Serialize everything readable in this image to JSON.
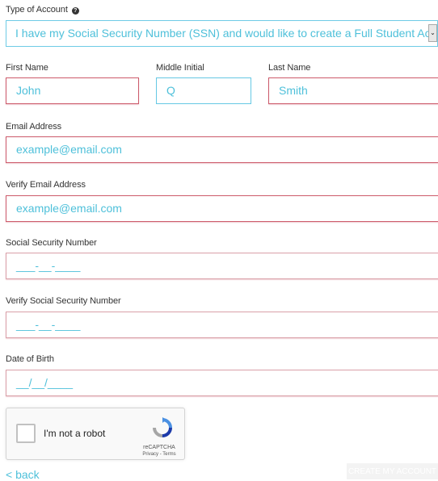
{
  "account_type": {
    "label": "Type of Account",
    "selected": "I have my Social Security Number (SSN) and would like to create a Full Student Account",
    "arrow": "⌄"
  },
  "name": {
    "first_label": "First Name",
    "first_placeholder": "John",
    "middle_label": "Middle Initial",
    "middle_placeholder": "Q",
    "last_label": "Last Name",
    "last_placeholder": "Smith"
  },
  "email": {
    "label": "Email Address",
    "placeholder": "example@email.com"
  },
  "verify_email": {
    "label": "Verify Email Address",
    "placeholder": "example@email.com"
  },
  "ssn": {
    "label": "Social Security Number",
    "placeholder": "___-__-____"
  },
  "verify_ssn": {
    "label": "Verify Social Security Number",
    "placeholder": "___-__-____"
  },
  "dob": {
    "label": "Date of Birth",
    "placeholder": "__/__/____"
  },
  "recaptcha": {
    "label": "I'm not a robot",
    "brand": "reCAPTCHA",
    "links": "Privacy - Terms"
  },
  "footer": {
    "back": "< back",
    "create": "CREATE MY ACCOUNT"
  },
  "colors": {
    "accent": "#4ec0da",
    "error_border": "#cc5a6a",
    "focus_border": "#66c8e4"
  }
}
